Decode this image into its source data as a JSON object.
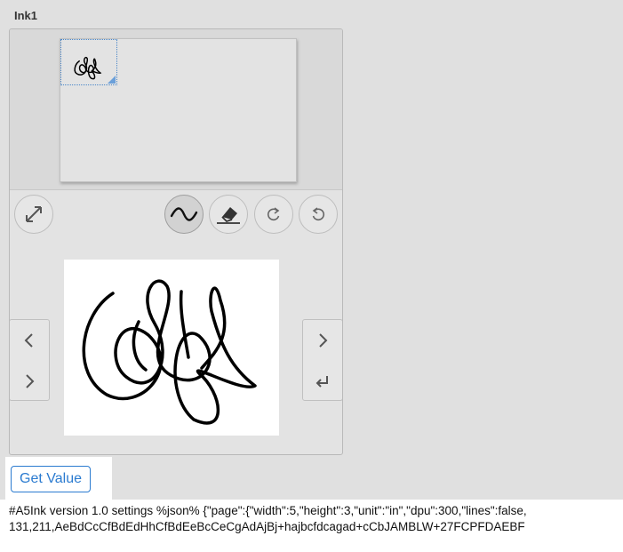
{
  "title": "Ink1",
  "toolbar": {
    "expand_icon": "expand-icon",
    "pen_icon": "wave-pen-icon",
    "eraser_icon": "eraser-icon",
    "redo_icon": "redo-icon",
    "undo_icon": "undo-icon",
    "active_tool": "pen"
  },
  "navigation": {
    "left": [
      "chevron-left-icon",
      "chevron-right-icon"
    ],
    "right": [
      "chevron-right-icon",
      "enter-icon"
    ]
  },
  "get_value_button": "Get Value",
  "value_lines": [
    "#A5Ink version 1.0 settings %json% {\"page\":{\"width\":5,\"height\":3,\"unit\":\"in\",\"dpu\":300,\"lines\":false,",
    "131,211,AeBdCcCfBdEdHhCfBdEeBcCeCgAdAjBj+hajbcfdcagad+cCbJAMBLW+27FCPFDAEBF"
  ],
  "colors": {
    "accent": "#2b7bd0",
    "background": "#e0e0e0",
    "panel": "#e3e3e3",
    "ink": "#000000"
  }
}
